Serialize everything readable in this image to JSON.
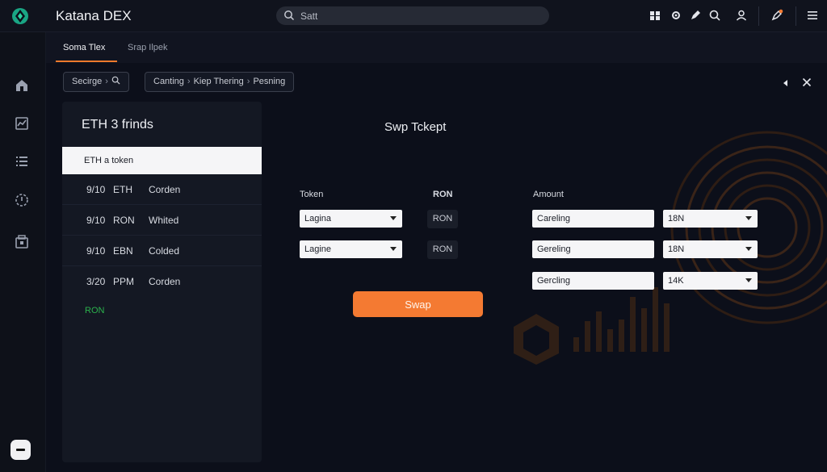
{
  "app": {
    "title": "Katana DEX"
  },
  "search": {
    "placeholder": "Satt"
  },
  "tabs": [
    {
      "label": "Soma Tlex",
      "active": true
    },
    {
      "label": "Srap Ilpek",
      "active": false
    }
  ],
  "breadcrumb": {
    "first": [
      "Secirge",
      "›"
    ],
    "second": [
      "Canting",
      "›",
      "Kiep Thering",
      "›",
      "Pesning"
    ]
  },
  "left_panel": {
    "title": "ETH 3 frinds",
    "selected_row": "ETH a token",
    "rows": [
      {
        "a": "9/10",
        "b": "ETH",
        "c": "Corden"
      },
      {
        "a": "9/10",
        "b": "RON",
        "c": "Whited"
      },
      {
        "a": "9/10",
        "b": "EBN",
        "c": "Colded"
      },
      {
        "a": "3/20",
        "b": "PPM",
        "c": "Corden"
      }
    ],
    "footer_token": "RON"
  },
  "swap": {
    "title": "Swp Tckept",
    "token_label": "Token",
    "ron_label": "RON",
    "amount_label": "Amount",
    "token_selects": [
      "Lagina",
      "Lagine"
    ],
    "ron_values": [
      "RON",
      "RON"
    ],
    "amount_inputs": [
      "Careling",
      "Gereling",
      "Gercling"
    ],
    "amount_units": [
      "18N",
      "18N",
      "14K"
    ],
    "button_label": "Swap"
  },
  "colors": {
    "accent": "#f47a32",
    "positive": "#2bb24c",
    "background": "#0c0f1a"
  }
}
